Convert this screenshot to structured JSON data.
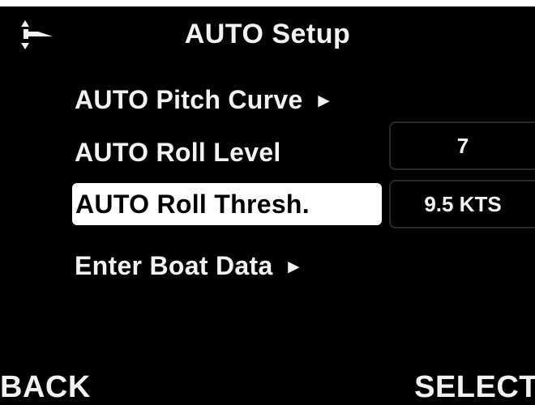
{
  "header": {
    "title": "AUTO Setup",
    "icon": "trim-tab-icon"
  },
  "menu": {
    "items": [
      {
        "label": "AUTO Pitch Curve",
        "submenu": true,
        "value": ""
      },
      {
        "label": "AUTO Roll Level",
        "submenu": false,
        "value": "7"
      },
      {
        "label": "AUTO Roll Thresh.",
        "submenu": false,
        "value": "9.5 KTS",
        "selected": true
      },
      {
        "label": "Enter Boat Data",
        "submenu": true,
        "value": ""
      }
    ],
    "submenu_arrow": "►"
  },
  "softkeys": {
    "left": "BACK",
    "right": "SELECT"
  },
  "colors": {
    "background": "#000000",
    "text": "#f2f2f2",
    "highlight_bg": "#ffffff",
    "highlight_text": "#000000"
  }
}
